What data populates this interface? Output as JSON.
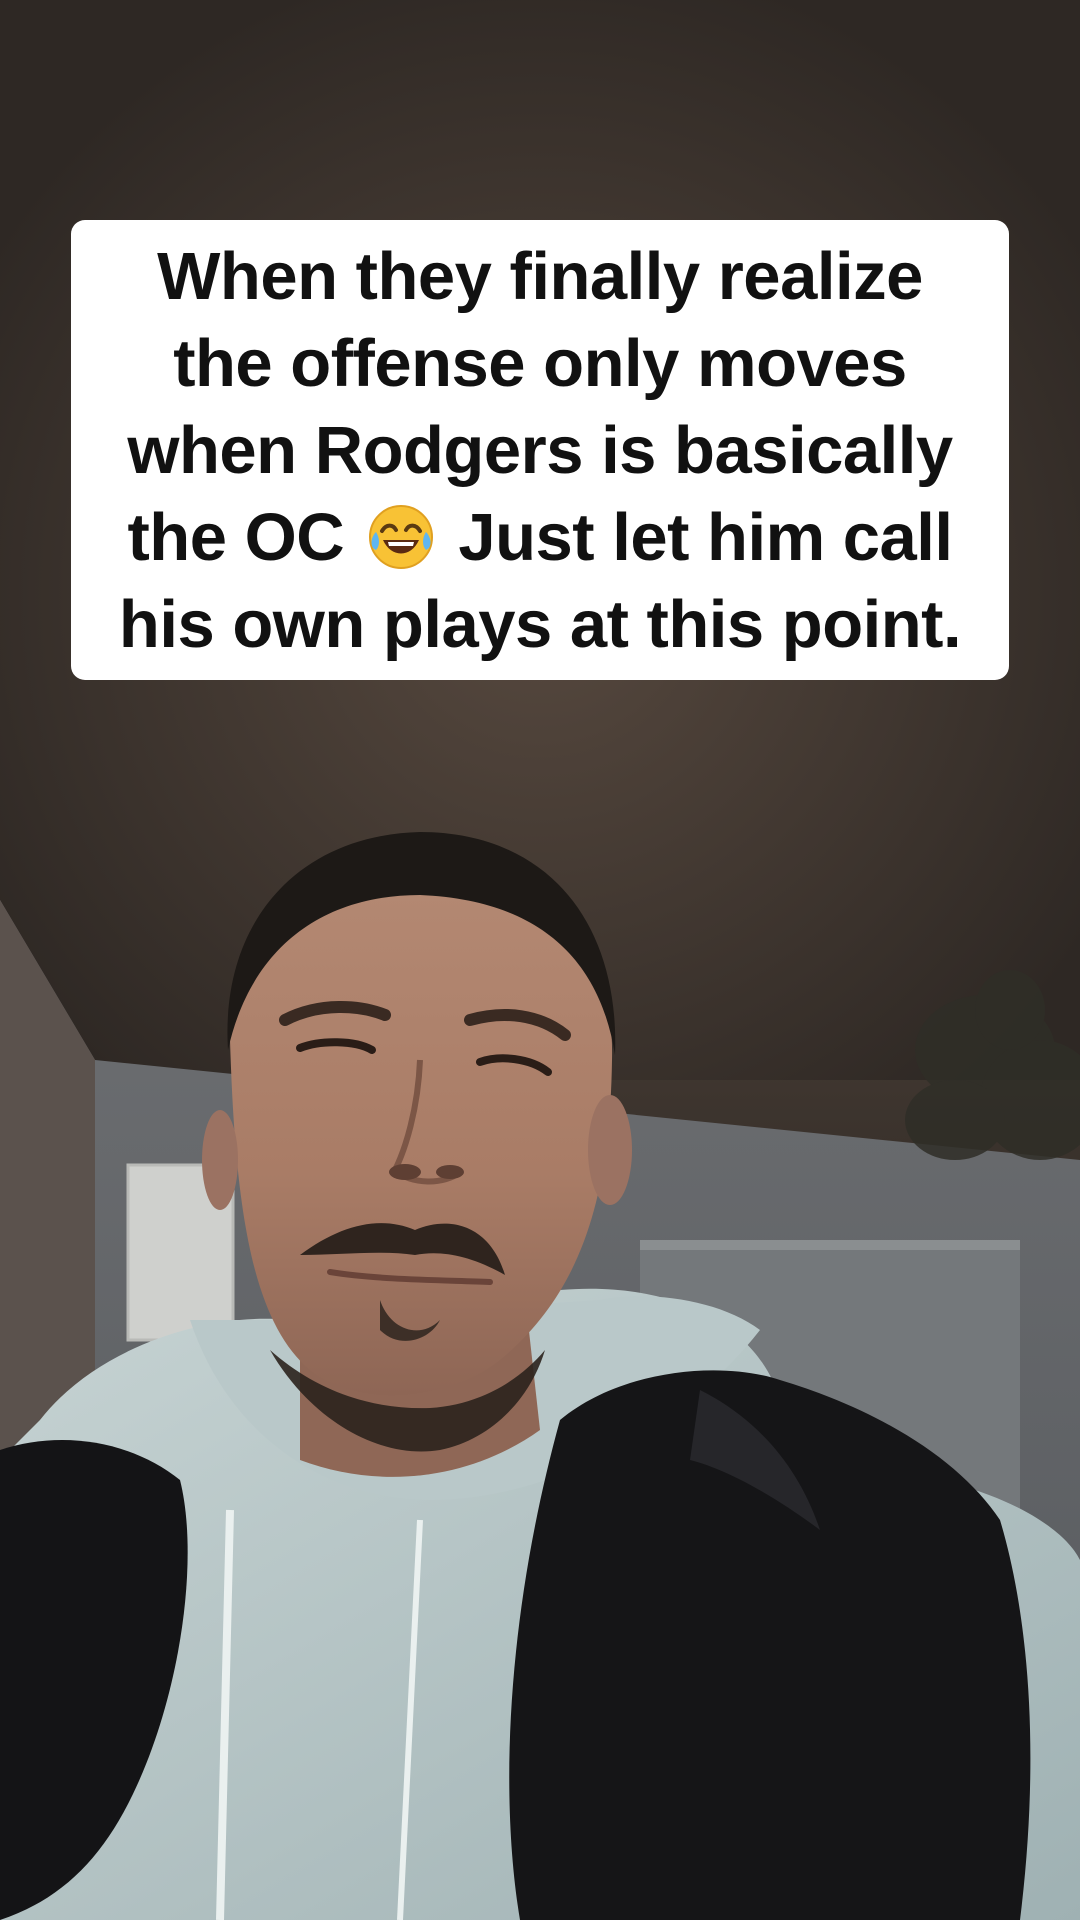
{
  "video": {
    "scene_description_icon": "person-selfie-video-frame"
  },
  "caption": {
    "lines": [
      "When they finally realize",
      "the offense only moves",
      "when Rodgers is basically",
      "the OC",
      "Just let him call",
      "his own plays at this point."
    ],
    "emoji_icon": "face-with-tears-of-joy-icon"
  },
  "colors": {
    "caption_background": "#ffffff",
    "caption_text": "#111111"
  }
}
